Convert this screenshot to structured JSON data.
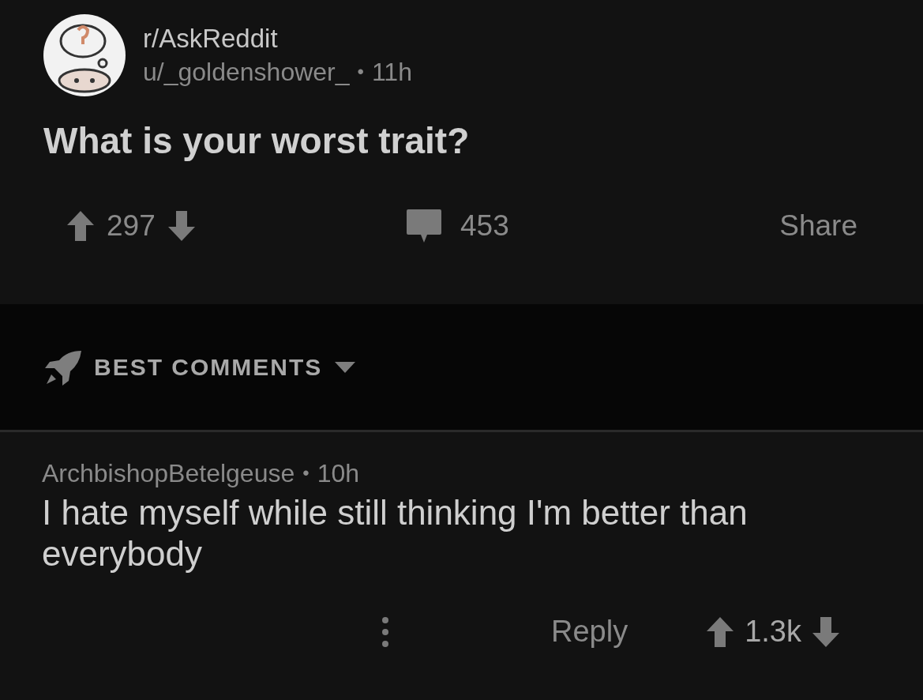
{
  "post": {
    "subreddit": "r/AskReddit",
    "author": "u/_goldenshower_",
    "separator": "•",
    "time": "11h",
    "title": "What is your worst trait?",
    "score": "297",
    "comments": "453",
    "share": "Share"
  },
  "sort": {
    "label": "BEST COMMENTS"
  },
  "comment": {
    "author": "ArchbishopBetelgeuse",
    "separator": "•",
    "time": "10h",
    "body": "I hate myself while still thinking I'm better than everybody",
    "reply": "Reply",
    "score": "1.3k"
  }
}
